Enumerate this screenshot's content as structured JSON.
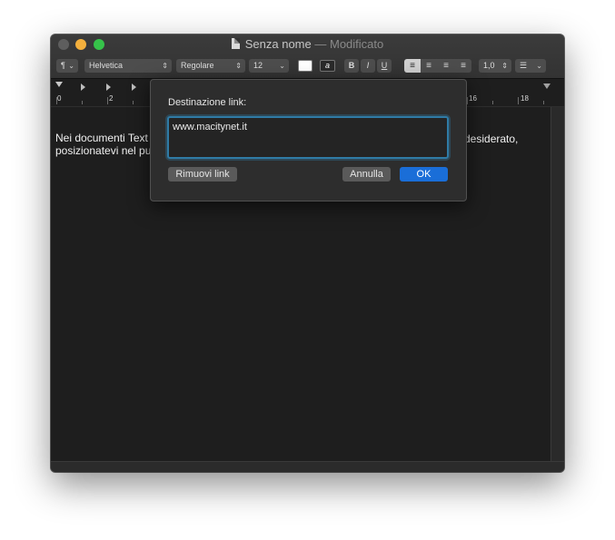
{
  "window": {
    "title": "Senza nome",
    "title_separator": " — ",
    "title_status": "Modificato"
  },
  "toolbar": {
    "paragraph_style": "¶",
    "font_family": "Helvetica",
    "font_style": "Regolare",
    "font_size": "12",
    "text_color_label": "a",
    "bold": "B",
    "italic": "I",
    "underline": "U",
    "line_spacing": "1,0",
    "list_style": "☰"
  },
  "ruler": {
    "numbers": [
      "0",
      "2",
      "16",
      "18"
    ]
  },
  "document": {
    "line1_start": "Nei documenti Text",
    "line1_end": "desiderato,",
    "line2_start": "posizionatevi nel pu"
  },
  "link_popover": {
    "label": "Destinazione link:",
    "url_value": "www.macitynet.it",
    "remove_button": "Rimuovi link",
    "cancel_button": "Annulla",
    "ok_button": "OK"
  },
  "colors": {
    "accent": "#1a6ed8",
    "focus_ring": "#2f7ba6",
    "close": "#5e5e5e",
    "minimize": "#f4b03d",
    "maximize": "#36c24a"
  }
}
